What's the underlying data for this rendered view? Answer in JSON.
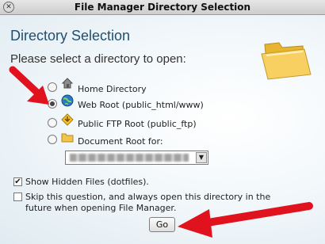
{
  "window": {
    "title": "File Manager Directory Selection",
    "close_icon": "close-icon"
  },
  "heading": "Directory Selection",
  "prompt": "Please select a directory to open:",
  "options": [
    {
      "label": "Home Directory",
      "icon": "home-icon",
      "selected": false
    },
    {
      "label": "Web Root (public_html/www)",
      "icon": "globe-icon",
      "selected": true
    },
    {
      "label": "Public FTP Root (public_ftp)",
      "icon": "ftp-icon",
      "selected": false
    },
    {
      "label": "Document Root for:",
      "icon": "folder-icon",
      "selected": false
    }
  ],
  "document_root_select": {
    "value": ""
  },
  "show_hidden": {
    "label": "Show Hidden Files (dotfiles).",
    "checked": true
  },
  "skip_question": {
    "label": "Skip this question, and always open this directory in the future when opening File Manager.",
    "checked": false
  },
  "go_button": "Go",
  "colors": {
    "arrow": "#e0121e",
    "heading": "#1e4f72",
    "folder": "#f2c44a"
  }
}
